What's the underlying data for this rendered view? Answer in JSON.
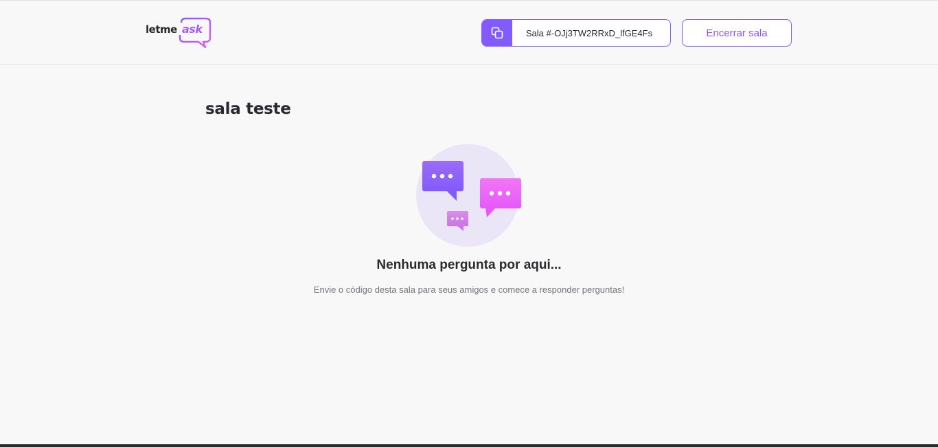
{
  "header": {
    "logo": {
      "part1": "letme",
      "part2": "ask"
    },
    "room_code": {
      "label": "Sala #-OJj3TW2RRxD_lfGE4Fs",
      "icon": "copy-icon"
    },
    "end_room_label": "Encerrar sala"
  },
  "main": {
    "room_title": "sala teste",
    "empty_state": {
      "title": "Nenhuma pergunta por aqui...",
      "subtitle": "Envie o código desta sala para seus amigos e comece a responder perguntas!",
      "icon": "chat-bubbles-icon"
    }
  },
  "colors": {
    "primary": "#835afd",
    "pink": "#e559f9",
    "text": "#29292e",
    "muted": "#737380",
    "background": "#f8f8f8"
  }
}
